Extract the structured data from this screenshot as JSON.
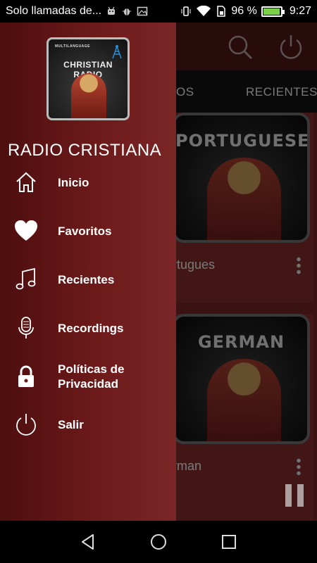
{
  "status_bar": {
    "notification_text": "Solo llamadas de...",
    "battery_percent": "96 %",
    "battery_level": 0.96,
    "time": "9:27",
    "icons": [
      "android-icon",
      "bug-icon",
      "image-icon",
      "vibrate-icon",
      "wifi-icon",
      "sim-icon",
      "battery-icon"
    ]
  },
  "background_app": {
    "tabs": [
      "OS",
      "RECIENTES"
    ],
    "items": [
      {
        "art_word": "PORTUGUESE",
        "label": "ortugues"
      },
      {
        "art_word": "GERMAN",
        "label": "erman"
      }
    ]
  },
  "drawer": {
    "logo": {
      "small_text": "MULTILANGUAGE",
      "title": "CHRISTIAN RADIO"
    },
    "title": "RADIO CRISTIANA",
    "items": [
      {
        "label": "Inicio",
        "icon": "home-icon"
      },
      {
        "label": "Favoritos",
        "icon": "heart-icon"
      },
      {
        "label": "Recientes",
        "icon": "music-note-icon"
      },
      {
        "label": "Recordings",
        "icon": "microphone-icon"
      },
      {
        "label": "Políticas de Privacidad",
        "icon": "lock-icon"
      },
      {
        "label": "Salir",
        "icon": "power-icon"
      }
    ]
  },
  "colors": {
    "drawer_dark": "#4d0e0e",
    "drawer_light": "#7b2626",
    "status_bar": "#000000",
    "battery_fill": "#7bd04a"
  }
}
